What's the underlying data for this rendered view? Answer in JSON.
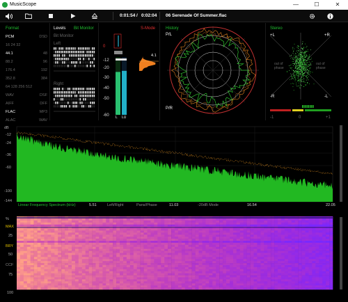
{
  "window": {
    "title": "MusicScope",
    "minimize": "—",
    "maximize": "☐",
    "close": "✕"
  },
  "toolbar": {
    "position": "0:01:54",
    "divider": "/",
    "duration": "0:02:04",
    "track": "06 Serenade Of Summer.flac",
    "icons": [
      "volume-icon",
      "folder-icon",
      "stop-icon",
      "play-icon",
      "eject-icon",
      "gear-icon",
      "info-icon"
    ]
  },
  "format": {
    "title": "Format",
    "rows": [
      {
        "l": "PCM",
        "r": "DSD"
      },
      {
        "l": "16  24  32",
        "r": ""
      },
      {
        "l": "44.1",
        "r": "48"
      },
      {
        "l": "88.2",
        "r": "96"
      },
      {
        "l": "176.4",
        "r": "192"
      },
      {
        "l": "352.8",
        "r": "384"
      },
      {
        "l": "64 128 256 512",
        "r": ""
      },
      {
        "l": "WAV",
        "r": "DSF"
      },
      {
        "l": "AIFF",
        "r": "DFF"
      },
      {
        "l": "FLAC",
        "r": "MP3"
      },
      {
        "l": "ALAC",
        "r": "WAV"
      }
    ],
    "active": [
      "PCM",
      "44.1",
      "FLAC"
    ]
  },
  "levels": {
    "title": "Levels",
    "mode": "Bit Monitor",
    "sub": "Bit Monitor",
    "left": "Left",
    "right": "Right"
  },
  "meter": {
    "mode": "S-Mode",
    "scale": [
      "0",
      "-12",
      "-20",
      "-30",
      "-40",
      "-50",
      "-60"
    ],
    "peak": "4.1",
    "ch_left": "L",
    "ch_right": "LU",
    "levels": {
      "left": 0.78,
      "right": 0.8
    }
  },
  "history": {
    "title": "History",
    "top": "P/L",
    "bottom": "P/R"
  },
  "stereo": {
    "title": "Stereo",
    "tl": "+L",
    "tr": "+R",
    "bl": "-R",
    "br": "-L",
    "out_left": "out of\nphase",
    "out_right": "out of\nphase",
    "corr": [
      "-1",
      "0",
      "+1"
    ]
  },
  "spectrum": {
    "db_labels": [
      "dB",
      "-12",
      "-24",
      "-36",
      "-60",
      "-100",
      "-144"
    ],
    "x_labels": [
      "Linear Frequency Spectrum (kHz)",
      "5.51",
      "Left/Right",
      "Pans/Phase",
      "11.03",
      "-20dB Mode",
      "16.54",
      "22.05"
    ]
  },
  "spectrogram": {
    "labels": [
      "%",
      "MAX",
      "25",
      "BRY",
      "50",
      "CCF",
      "75",
      "100"
    ]
  },
  "colors": {
    "green": "#20c030",
    "accent_red": "#e03030",
    "accent_orange": "#e08020",
    "meter_blue": "#22b0c8"
  }
}
